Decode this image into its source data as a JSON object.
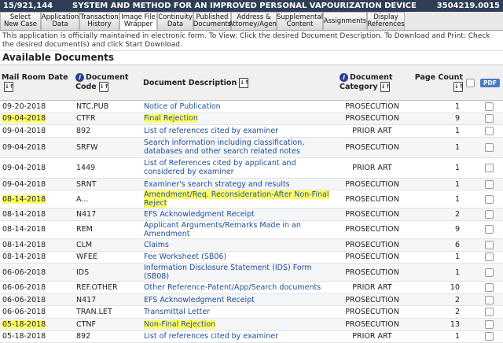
{
  "titlebar": {
    "app_number": "15/921,144",
    "title": "SYSTEM AND METHOD FOR AN IMPROVED PERSONAL VAPOURIZATION DEVICE",
    "doc_id": "3504219.0015"
  },
  "tabs": [
    {
      "label": "Select\nNew Case",
      "width": 52
    },
    {
      "label": "Application\nData",
      "width": 49
    },
    {
      "label": "Transaction\nHistory",
      "width": 51
    },
    {
      "label": "Image File\nWrapper",
      "width": 48,
      "active": true
    },
    {
      "label": "Continuity\nData",
      "width": 46
    },
    {
      "label": "Published\nDocuments",
      "width": 48
    },
    {
      "label": "Address &\nAttorney/Agent",
      "width": 58
    },
    {
      "label": "Supplemental\nContent",
      "width": 59
    },
    {
      "label": "Assignments",
      "width": 56
    },
    {
      "label": "Display\nReferences",
      "width": 48
    }
  ],
  "info_text": "This application is officially maintained in electronic form. To View: Click the desired Document Description. To Download and Print: Check the desired document(s) and click Start Download.",
  "section_title": "Available Documents",
  "columns": {
    "date": "Mail Room Date",
    "code": "Document Code",
    "desc": "Document Description",
    "cat": "Document Category",
    "pages": "Page Count",
    "pdf": "PDF"
  },
  "rows": [
    {
      "date": "09-20-2018",
      "code": "NTC.PUB",
      "desc": "Notice of Publication",
      "cat": "PROSECUTION",
      "pages": "1",
      "hl": false
    },
    {
      "date": "09-04-2018",
      "code": "CTFR",
      "desc": "Final Rejection",
      "cat": "PROSECUTION",
      "pages": "9",
      "hl": true
    },
    {
      "date": "09-04-2018",
      "code": "892",
      "desc": "List of references cited by examiner",
      "cat": "PRIOR ART",
      "pages": "1",
      "hl": false
    },
    {
      "date": "09-04-2018",
      "code": "SRFW",
      "desc": "Search information including classification, databases and other search related notes",
      "cat": "PROSECUTION",
      "pages": "1",
      "hl": false,
      "tall": true
    },
    {
      "date": "09-04-2018",
      "code": "1449",
      "desc": "List of References cited by applicant and considered by examiner",
      "cat": "PRIOR ART",
      "pages": "1",
      "hl": false,
      "tall": true
    },
    {
      "date": "09-04-2018",
      "code": "SRNT",
      "desc": "Examiner's search strategy and results",
      "cat": "PROSECUTION",
      "pages": "1",
      "hl": false
    },
    {
      "date": "08-14-2018",
      "code": "A...",
      "desc": "Amendment/Req. Reconsideration-After Non-Final Reject",
      "cat": "PROSECUTION",
      "pages": "1",
      "hl": true
    },
    {
      "date": "08-14-2018",
      "code": "N417",
      "desc": "EFS Acknowledgment Receipt",
      "cat": "PROSECUTION",
      "pages": "2",
      "hl": false
    },
    {
      "date": "08-14-2018",
      "code": "REM",
      "desc": "Applicant Arguments/Remarks Made in an Amendment",
      "cat": "PROSECUTION",
      "pages": "9",
      "hl": false
    },
    {
      "date": "08-14-2018",
      "code": "CLM",
      "desc": "Claims",
      "cat": "PROSECUTION",
      "pages": "6",
      "hl": false
    },
    {
      "date": "08-14-2018",
      "code": "WFEE",
      "desc": "Fee Worksheet (SB06)",
      "cat": "PROSECUTION",
      "pages": "1",
      "hl": false
    },
    {
      "date": "06-06-2018",
      "code": "IDS",
      "desc": "Information Disclosure Statement (IDS) Form (SB08)",
      "cat": "PROSECUTION",
      "pages": "1",
      "hl": false
    },
    {
      "date": "06-06-2018",
      "code": "REF.OTHER",
      "desc": "Other Reference-Patent/App/Search documents",
      "cat": "PRIOR ART",
      "pages": "10",
      "hl": false
    },
    {
      "date": "06-06-2018",
      "code": "N417",
      "desc": "EFS Acknowledgment Receipt",
      "cat": "PROSECUTION",
      "pages": "2",
      "hl": false
    },
    {
      "date": "06-06-2018",
      "code": "TRAN.LET",
      "desc": "Transmittal Letter",
      "cat": "PROSECUTION",
      "pages": "2",
      "hl": false
    },
    {
      "date": "05-18-2018",
      "code": "CTNF",
      "desc": "Non-Final Rejection",
      "cat": "PROSECUTION",
      "pages": "13",
      "hl": true
    },
    {
      "date": "05-18-2018",
      "code": "892",
      "desc": "List of references cited by examiner",
      "cat": "PRIOR ART",
      "pages": "1",
      "hl": false
    }
  ]
}
